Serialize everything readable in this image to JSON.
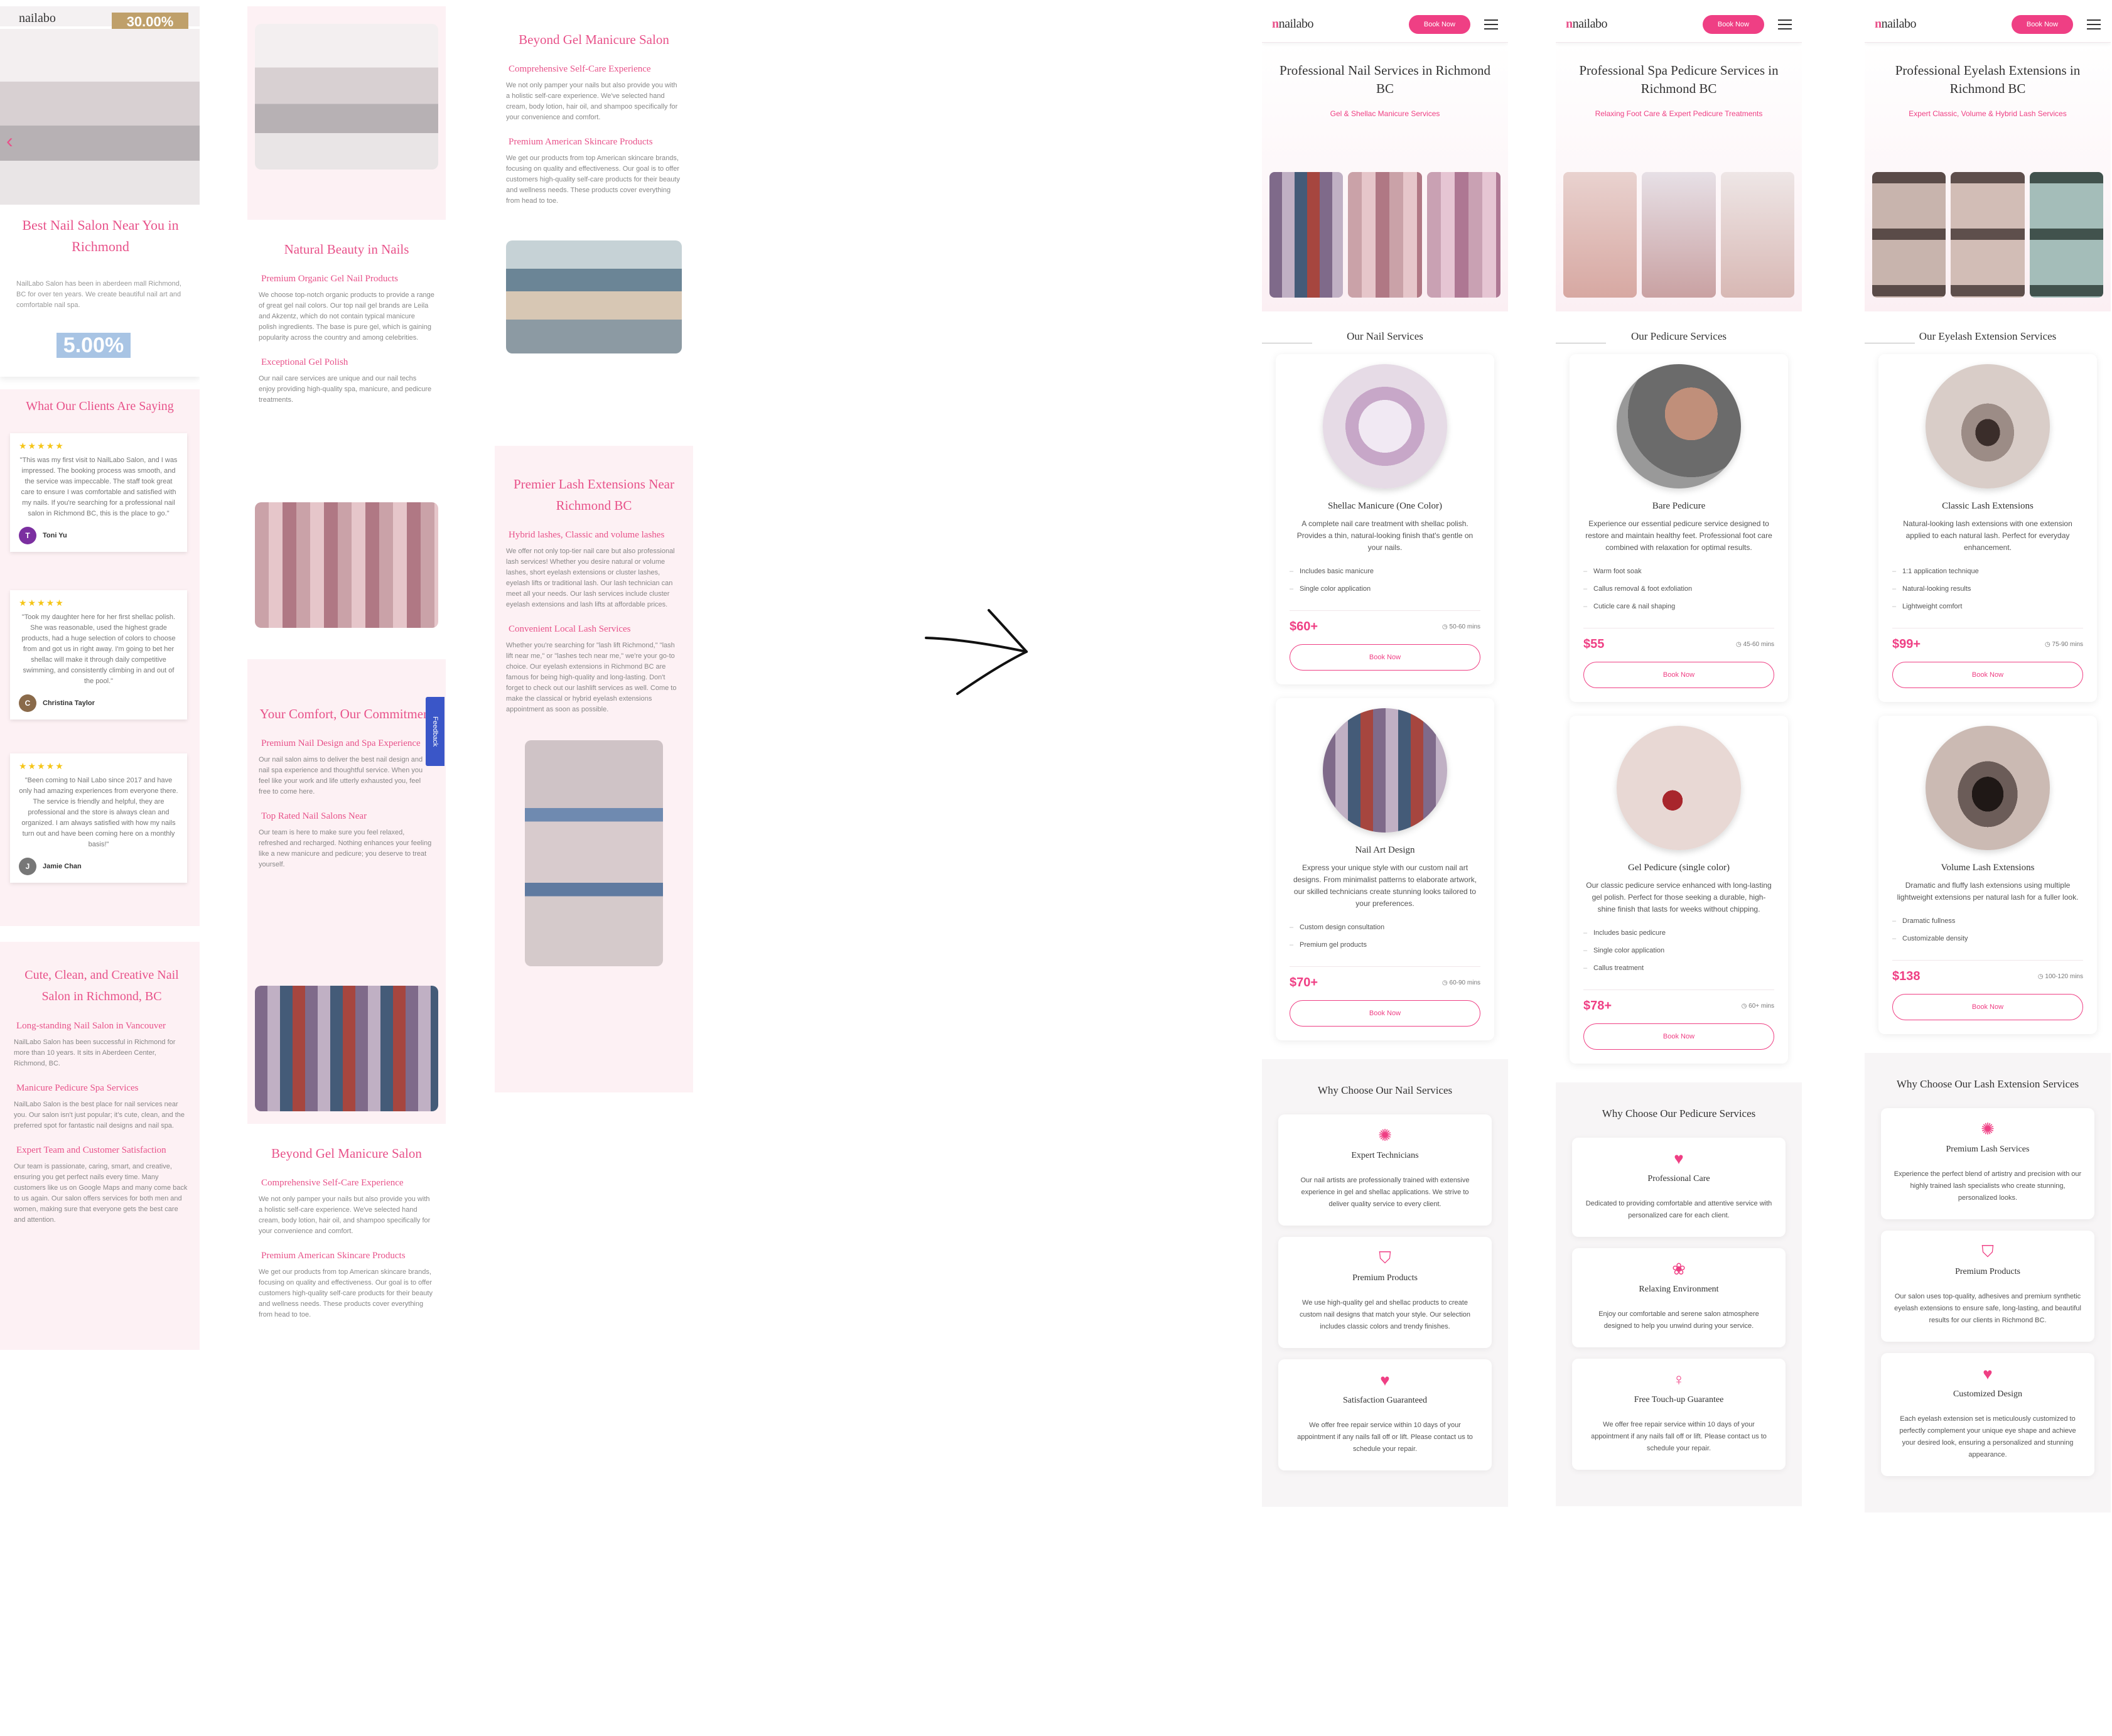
{
  "left1": {
    "logo": "nailabo",
    "promo": "30.00%",
    "hero_title": "Best Nail Salon Near You in Richmond",
    "hero_text": "NailLabo Salon has been in aberdeen mall Richmond, BC for over ten years. We create beautiful nail art and comfortable nail spa.",
    "percent": "5.00%",
    "testimonials_title": "What Our Clients Are Saying",
    "testimonials": [
      {
        "stars": "★★★★★",
        "quote": "\"This was my first visit to NailLabo Salon, and I was impressed. The booking process was smooth, and the service was impeccable. The staff took great care to ensure I was comfortable and satisfied with my nails. If you're searching for a professional nail salon in Richmond BC, this is the place to go.\"",
        "name": "Toni Yu",
        "initial": "T"
      },
      {
        "stars": "★★★★★",
        "quote": "\"Took my daughter here for her first shellac polish. She was reasonable, used the highest grade products, had a huge selection of colors to choose from and got us in right away. I'm going to bet her shellac will make it through daily competitive swimming, and consistently climbing in and out of the pool.\"",
        "name": "Christina Taylor",
        "initial": "C"
      },
      {
        "stars": "★★★★★",
        "quote": "\"Been coming to Nail Labo since 2017 and have only had amazing experiences from everyone there. The service is friendly and helpful, they are professional and the store is always clean and organized. I am always satisfied with how my nails turn out and have been coming here on a monthly basis!\"",
        "name": "Jamie Chan",
        "initial": "J"
      }
    ],
    "cute_title": "Cute, Clean, and Creative Nail Salon in Richmond, BC",
    "cute_blocks": [
      {
        "h": "Long-standing Nail Salon in Vancouver",
        "p": "NailLabo Salon has been successful in Richmond for more than 10 years. It sits in Aberdeen Center, Richmond, BC."
      },
      {
        "h": "Manicure Pedicure Spa Services",
        "p": "NailLabo Salon is the best place for nail services near you. Our salon isn't just popular; it's cute, clean, and the preferred spot for fantastic nail designs and nail spa."
      },
      {
        "h": "Expert Team and Customer Satisfaction",
        "p": "Our team is passionate, caring, smart, and creative, ensuring you get perfect nails every time. Many customers like us on Google Maps and many come back to us again. Our salon offers services for both men and women, making sure that everyone gets the best care and attention."
      }
    ]
  },
  "left2": {
    "natural_title": "Natural Beauty in Nails",
    "natural_blocks": [
      {
        "h": "Premium Organic Gel Nail Products",
        "p": "We choose top-notch organic products to provide a range of great gel nail colors. Our top nail gel brands are Leila and Akzentz, which do not contain typical manicure polish ingredients. The base is pure gel, which is gaining popularity across the country and among celebrities."
      },
      {
        "h": "Exceptional Gel Polish",
        "p": "Our nail care services are unique and our nail techs enjoy providing high-quality spa, manicure, and pedicure treatments."
      }
    ],
    "comfort_title": "Your Comfort, Our Commitment",
    "comfort_blocks": [
      {
        "h": "Premium Nail Design and Spa Experience",
        "p": "Our nail salon aims to deliver the best nail design and nail spa experience and thoughtful service. When you feel like your work and life utterly exhausted you, feel free to come here."
      },
      {
        "h": "Top Rated Nail Salons Near",
        "p": "Our team is here to make sure you feel relaxed, refreshed and recharged. Nothing enhances your feeling like a new manicure and pedicure; you deserve to treat yourself."
      }
    ],
    "beyond_title": "Beyond Gel Manicure Salon",
    "beyond_blocks": [
      {
        "h": "Comprehensive Self-Care Experience",
        "p": "We not only pamper your nails but also provide you with a holistic self-care experience. We've selected hand cream, body lotion, hair oil, and shampoo specifically for your convenience and comfort."
      },
      {
        "h": "Premium American Skincare Products",
        "p": "We get our products from top American skincare brands, focusing on quality and effectiveness. Our goal is to offer customers high-quality self-care products for their beauty and wellness needs. These products cover everything from head to toe."
      }
    ],
    "feedback": "Feedback"
  },
  "left3": {
    "beyond_title": "Beyond Gel Manicure Salon",
    "beyond_blocks": [
      {
        "h": "Comprehensive Self-Care Experience",
        "p": "We not only pamper your nails but also provide you with a holistic self-care experience. We've selected hand cream, body lotion, hair oil, and shampoo specifically for your convenience and comfort."
      },
      {
        "h": "Premium American Skincare Products",
        "p": "We get our products from top American skincare brands, focusing on quality and effectiveness. Our goal is to offer customers high-quality self-care products for their beauty and wellness needs. These products cover everything from head to toe."
      }
    ],
    "lash_title": "Premier Lash Extensions Near Richmond BC",
    "lash_blocks": [
      {
        "h": "Hybrid lashes, Classic and volume lashes",
        "p": "We offer not only top-tier nail care but also professional lash services! Whether you desire natural or volume lashes, short eyelash extensions or cluster lashes, eyelash lifts or traditional lash. Our lash technician can meet all your needs. Our lash services include cluster eyelash extensions and lash lifts at affordable prices."
      },
      {
        "h": "Convenient Local Lash Services",
        "p": "Whether you're searching for \"lash lift Richmond,\" \"lash lift near me,\" or \"lashes tech near me,\" we're your go-to choice. Our eyelash extensions in Richmond BC are famous for being high-quality and long-lasting. Don't forget to check out our lashlift services as well. Come to make the classical or hybrid eyelash extensions appointment as soon as possible."
      }
    ]
  },
  "phones": [
    {
      "logo": "nailabo",
      "book": "Book Now",
      "title": "Professional Nail Services in Richmond BC",
      "subtitle": "Gel & Shellac Manicure Services",
      "section": "Our Nail Services",
      "services": [
        {
          "name": "Shellac Manicure (One Color)",
          "desc": "A complete nail care treatment with shellac polish. Provides a thin, natural-looking finish that's gentle on your nails.",
          "features": [
            "Includes basic manicure",
            "Single color application"
          ],
          "price": "$60+",
          "duration": "50-60 mins",
          "btn": "Book Now"
        },
        {
          "name": "Nail Art Design",
          "desc": "Express your unique style with our custom nail art designs. From minimalist patterns to elaborate artwork, our skilled technicians create stunning looks tailored to your preferences.",
          "features": [
            "Custom design consultation",
            "Premium gel products"
          ],
          "price": "$70+",
          "duration": "60-90 mins",
          "btn": "Book Now"
        }
      ],
      "why_title": "Why Choose Our Nail Services",
      "why": [
        {
          "icon": "✺",
          "title": "Expert Technicians",
          "text": "Our nail artists are professionally trained with extensive experience in gel and shellac applications. We strive to deliver quality service to every client."
        },
        {
          "icon": "⛉",
          "title": "Premium Products",
          "text": "We use high-quality gel and shellac products to create custom nail designs that match your style. Our selection includes classic colors and trendy finishes."
        },
        {
          "icon": "♥",
          "title": "Satisfaction Guaranteed",
          "text": "We offer free repair service within 10 days of your appointment if any nails fall off or lift. Please contact us to schedule your repair."
        }
      ]
    },
    {
      "logo": "nailabo",
      "book": "Book Now",
      "title": "Professional Spa Pedicure Services in Richmond BC",
      "subtitle": "Relaxing Foot Care & Expert Pedicure Treatments",
      "section": "Our Pedicure Services",
      "services": [
        {
          "name": "Bare Pedicure",
          "desc": "Experience our essential pedicure service designed to restore and maintain healthy feet. Professional foot care combined with relaxation for optimal results.",
          "features": [
            "Warm foot soak",
            "Callus removal & foot exfoliation",
            "Cuticle care & nail shaping"
          ],
          "price": "$55",
          "duration": "45-60 mins",
          "btn": "Book Now"
        },
        {
          "name": "Gel Pedicure (single color)",
          "desc": "Our classic pedicure service enhanced with long-lasting gel polish. Perfect for those seeking a durable, high-shine finish that lasts for weeks without chipping.",
          "features": [
            "Includes basic pedicure",
            "Single color application",
            "Callus treatment"
          ],
          "price": "$78+",
          "duration": "60+ mins",
          "btn": "Book Now"
        }
      ],
      "why_title": "Why Choose Our Pedicure Services",
      "why": [
        {
          "icon": "♥",
          "title": "Professional Care",
          "text": "Dedicated to providing comfortable and attentive service with personalized care for each client."
        },
        {
          "icon": "❀",
          "title": "Relaxing Environment",
          "text": "Enjoy our comfortable and serene salon atmosphere designed to help you unwind during your service."
        },
        {
          "icon": "♀",
          "title": "Free Touch-up Guarantee",
          "text": "We offer free repair service within 10 days of your appointment if any nails fall off or lift. Please contact us to schedule your repair."
        }
      ]
    },
    {
      "logo": "nailabo",
      "book": "Book Now",
      "title": "Professional Eyelash Extensions in Richmond BC",
      "subtitle": "Expert Classic, Volume & Hybrid Lash Services",
      "section": "Our Eyelash Extension Services",
      "services": [
        {
          "name": "Classic Lash Extensions",
          "desc": "Natural-looking lash extensions with one extension applied to each natural lash. Perfect for everyday enhancement.",
          "features": [
            "1:1 application technique",
            "Natural-looking results",
            "Lightweight comfort"
          ],
          "price": "$99+",
          "duration": "75-90 mins",
          "btn": "Book Now"
        },
        {
          "name": "Volume Lash Extensions",
          "desc": "Dramatic and fluffy lash extensions using multiple lightweight extensions per natural lash for a fuller look.",
          "features": [
            "Dramatic fullness",
            "Customizable density"
          ],
          "price": "$138",
          "duration": "100-120 mins",
          "btn": "Book Now"
        }
      ],
      "why_title": "Why Choose Our Lash Extension Services",
      "why": [
        {
          "icon": "✺",
          "title": "Premium Lash Services",
          "text": "Experience the perfect blend of artistry and precision with our highly trained lash specialists who create stunning, personalized looks."
        },
        {
          "icon": "⛉",
          "title": "Premium Products",
          "text": "Our salon uses top-quality, adhesives and premium synthetic eyelash extensions to ensure safe, long-lasting, and beautiful results for our clients in Richmond BC."
        },
        {
          "icon": "♥",
          "title": "Customized Design",
          "text": "Each eyelash extension set is meticulously customized to perfectly complement your unique eye shape and achieve your desired look, ensuring a personalized and stunning appearance."
        }
      ]
    }
  ]
}
